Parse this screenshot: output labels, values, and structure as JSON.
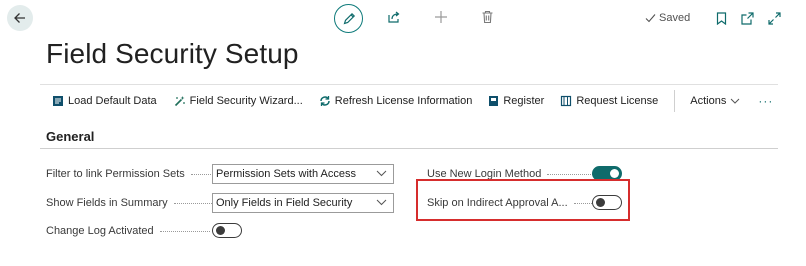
{
  "header": {
    "saved_label": "Saved",
    "icons": [
      "back-arrow-icon",
      "edit-pencil-icon",
      "share-icon",
      "add-icon",
      "delete-icon",
      "bookmark-icon",
      "open-new-window-icon",
      "expand-icon"
    ]
  },
  "page": {
    "title": "Field Security Setup"
  },
  "actions": {
    "load_default_data": "Load Default Data",
    "field_security_wizard": "Field Security Wizard...",
    "refresh_license": "Refresh License Information",
    "register": "Register",
    "request_license": "Request License",
    "actions_menu": "Actions",
    "more": "···"
  },
  "general": {
    "section_title": "General",
    "filter_permission_sets": {
      "label": "Filter to link Permission Sets",
      "value": "Permission Sets with Access"
    },
    "show_fields_summary": {
      "label": "Show Fields in Summary",
      "value": "Only Fields in Field Security"
    },
    "change_log_activated": {
      "label": "Change Log Activated",
      "checked": false
    },
    "use_new_login_method": {
      "label": "Use New Login Method",
      "checked": true
    },
    "skip_indirect_approval": {
      "label": "Skip on Indirect Approval A...",
      "checked": false
    }
  },
  "colors": {
    "accent": "#0f6b6b",
    "highlight": "#d62d2d"
  }
}
